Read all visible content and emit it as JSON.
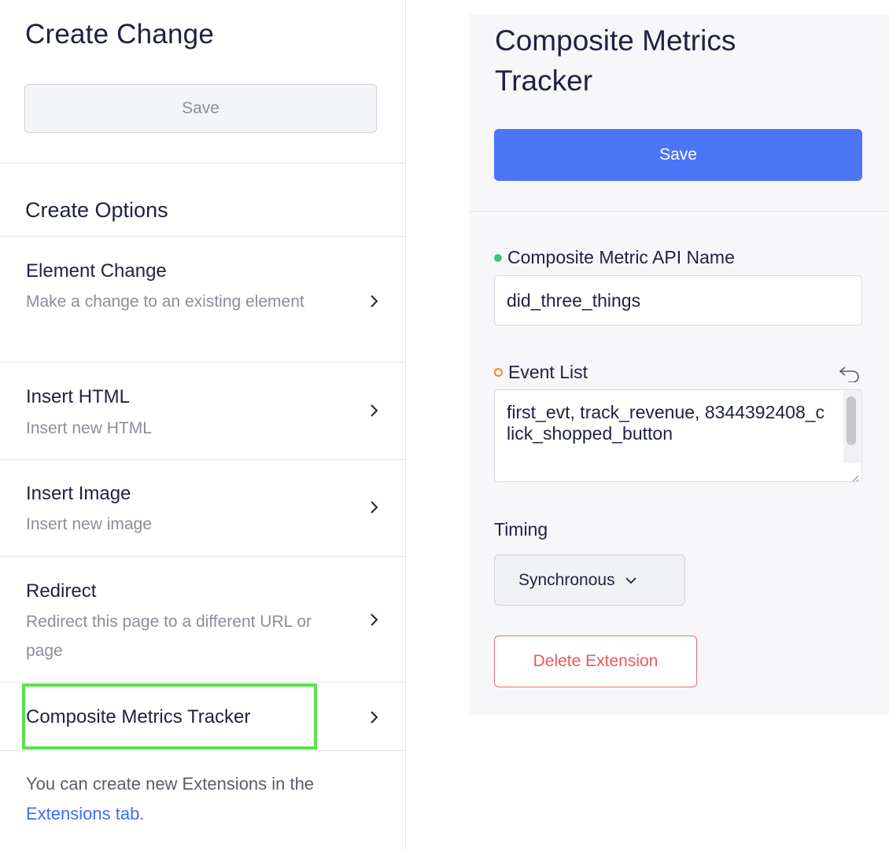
{
  "left": {
    "title": "Create Change",
    "save_label": "Save",
    "options_heading": "Create Options",
    "options": [
      {
        "title": "Element Change",
        "description": "Make a change to an existing element"
      },
      {
        "title": "Insert HTML",
        "description": "Insert new HTML"
      },
      {
        "title": "Insert Image",
        "description": "Insert new image"
      },
      {
        "title": "Redirect",
        "description": "Redirect this page to a different URL or page"
      },
      {
        "title": "Composite Metrics Tracker",
        "description": ""
      }
    ],
    "footer_text": "You can create new Extensions in the",
    "footer_link": "Extensions tab."
  },
  "right": {
    "title": "Composite Metrics Tracker",
    "save_label": "Save",
    "api_name_label": "Composite Metric API Name",
    "api_name_value": "did_three_things",
    "event_list_label": "Event List",
    "event_list_value": "first_evt, track_revenue, 8344392408_click_shopped_button",
    "timing_label": "Timing",
    "timing_value": "Synchronous",
    "delete_label": "Delete Extension"
  },
  "colors": {
    "primary": "#4a75f6",
    "highlight": "#57e34a",
    "danger": "#e9575e",
    "required_dot": "#3cc47c",
    "optional_dot": "#f08a24",
    "link": "#3d6ef5"
  },
  "icons": [
    "chevron-right-icon",
    "undo-icon",
    "chevron-down-icon",
    "resize-grip-icon"
  ]
}
